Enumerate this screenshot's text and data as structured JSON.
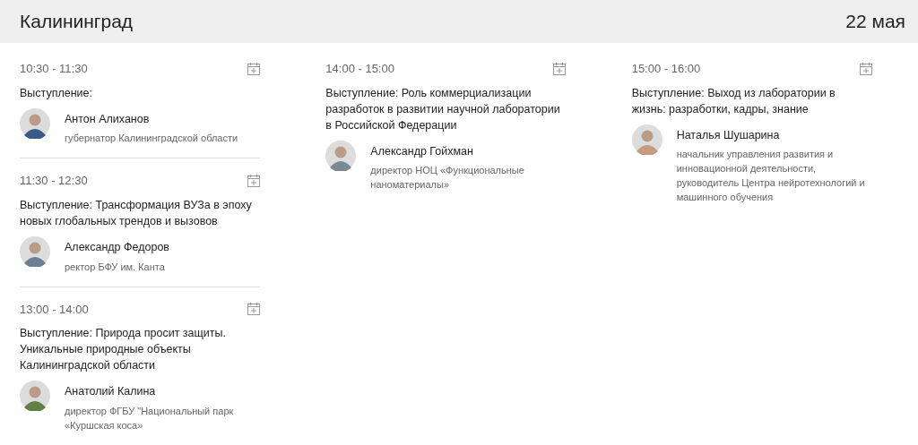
{
  "header": {
    "city": "Калининград",
    "date": "22 мая"
  },
  "columns": [
    {
      "sessions": [
        {
          "time": "10:30 - 11:30",
          "title": "Выступление:",
          "speaker": {
            "name": "Антон Алиханов",
            "position": "губернатор Калининградской области"
          }
        },
        {
          "time": "11:30 - 12:30",
          "title": "Выступление: Трансформация ВУЗа в эпоху новых глобальных трендов и вызовов",
          "speaker": {
            "name": "Александр Федоров",
            "position": "ректор БФУ им. Канта"
          }
        },
        {
          "time": "13:00 - 14:00",
          "title": "Выступление: Природа просит защиты. Уникальные природные объекты Калининградской области",
          "speaker": {
            "name": "Анатолий Калина",
            "position": "директор ФГБУ \"Национальный парк «Куршская коса»"
          }
        }
      ]
    },
    {
      "sessions": [
        {
          "time": "14:00 - 15:00",
          "title": "Выступление: Роль коммерциализации разработок в развитии научной лаборатории в Российской Федерации",
          "speaker": {
            "name": "Александр Гойхман",
            "position": "директор НОЦ «Функциональные наноматериалы»"
          }
        }
      ]
    },
    {
      "sessions": [
        {
          "time": "15:00 - 16:00",
          "title": "Выступление: Выход из лаборатории в жизнь: разработки, кадры, знание",
          "speaker": {
            "name": "Наталья Шушарина",
            "position": "начальник управления развития и инновационной деятельности, руководитель Центра нейротехнологий и машинного обучения"
          }
        }
      ]
    }
  ]
}
